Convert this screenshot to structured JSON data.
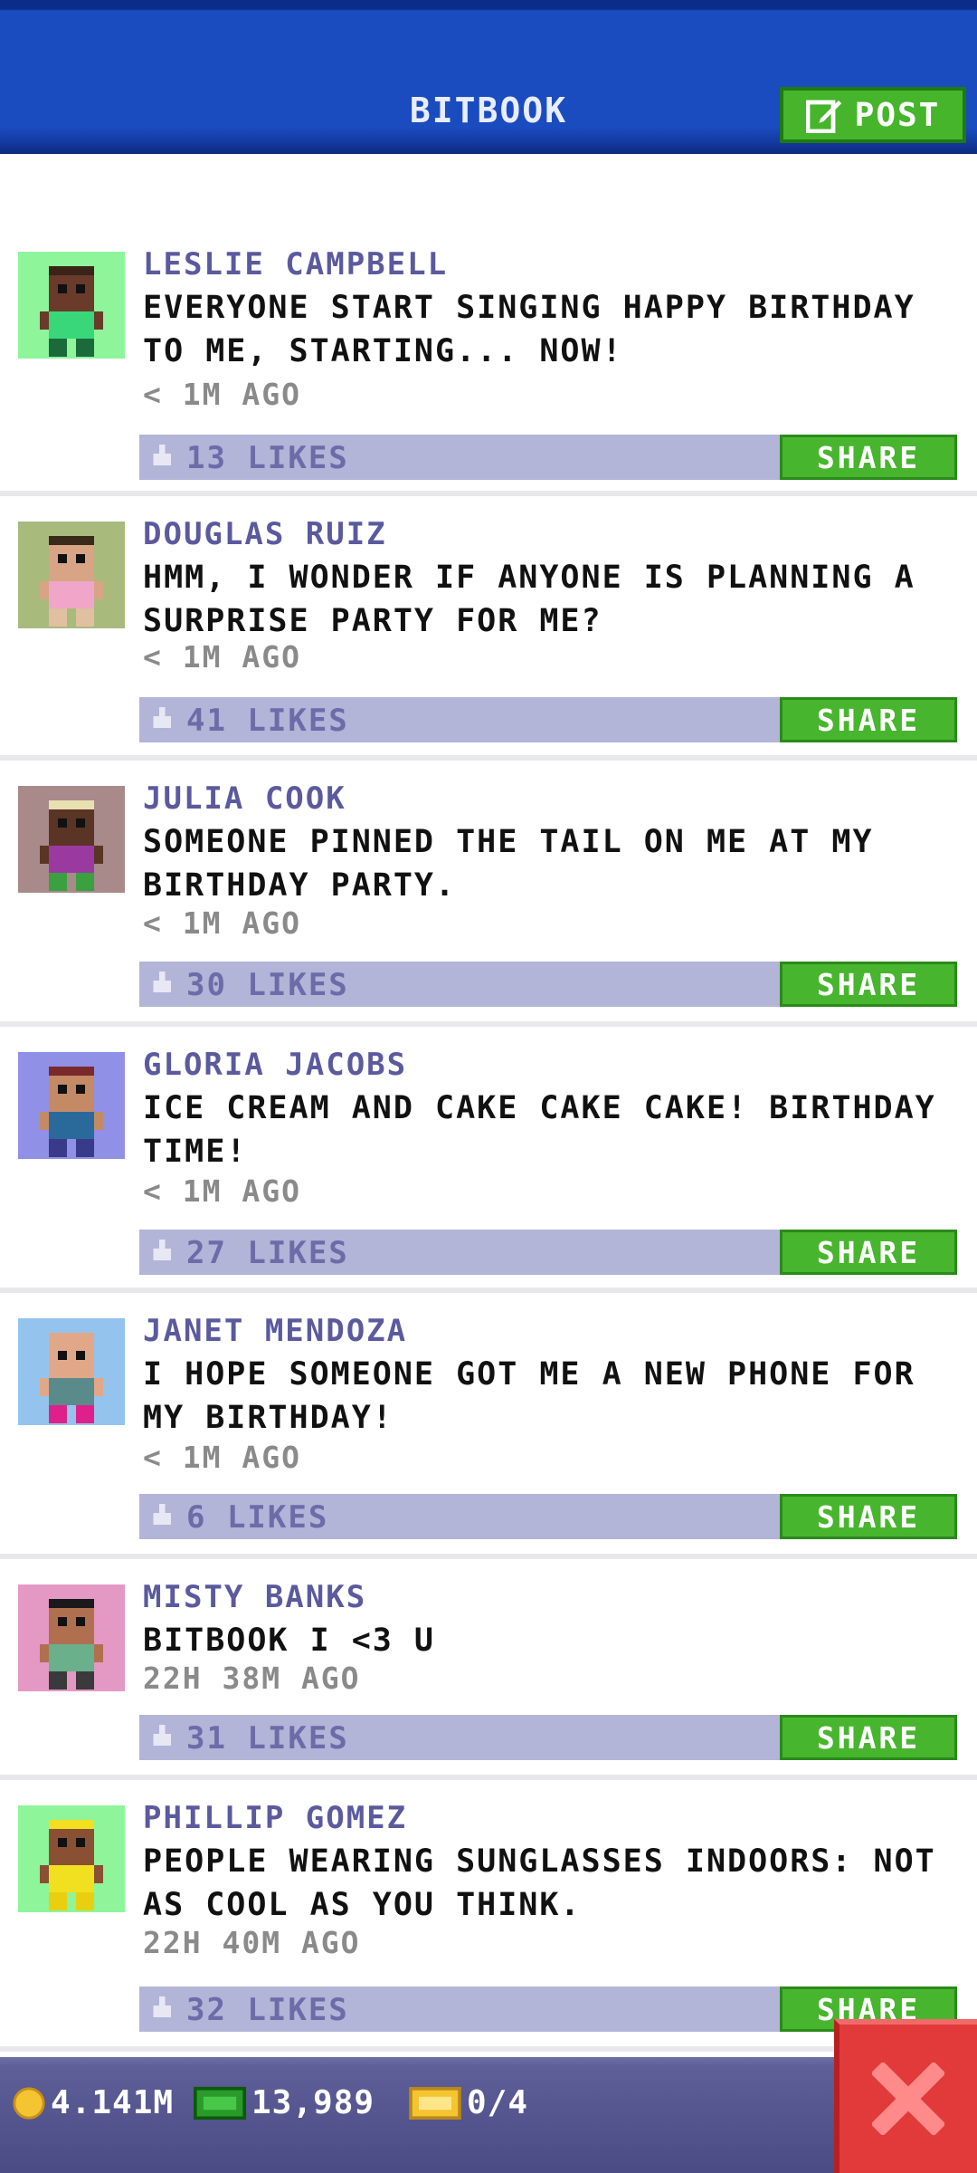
{
  "header": {
    "title": "BITBOOK",
    "post_label": "POST"
  },
  "posts": [
    {
      "name": "LESLIE CAMPBELL",
      "text": "EVERYONE START SINGING HAPPY BIRTHDAY TO ME, STARTING... NOW!",
      "time": "< 1M AGO",
      "likes": "13 LIKES",
      "share": "SHARE",
      "avatar_bg": "#8ef59a",
      "skin": "#6a3a2a",
      "shirt": "#39d67a",
      "pants": "#1b6a3a",
      "hair": "#3a2418"
    },
    {
      "name": "DOUGLAS RUIZ",
      "text": "HMM, I WONDER IF ANYONE IS PLANNING A SURPRISE PARTY FOR ME?",
      "time": "< 1M AGO",
      "likes": "41 LIKES",
      "share": "SHARE",
      "avatar_bg": "#a8ba7c",
      "skin": "#d7a585",
      "shirt": "#f0a6c8",
      "pants": "#e0c0a0",
      "hair": "#3a2a1a"
    },
    {
      "name": "JULIA COOK",
      "text": "SOMEONE PINNED THE TAIL ON ME AT MY BIRTHDAY PARTY.",
      "time": "< 1M AGO",
      "likes": "30 LIKES",
      "share": "SHARE",
      "avatar_bg": "#a88a8a",
      "skin": "#5a3424",
      "shirt": "#9a3aa0",
      "pants": "#3aa040",
      "hair": "#e8e0b0"
    },
    {
      "name": "GLORIA JACOBS",
      "text": "ICE CREAM AND CAKE CAKE CAKE! BIRTHDAY TIME!",
      "time": "< 1M AGO",
      "likes": "27 LIKES",
      "share": "SHARE",
      "avatar_bg": "#8f90e6",
      "skin": "#c48a66",
      "shirt": "#2a6a9a",
      "pants": "#3a3a8a",
      "hair": "#7a2a2a"
    },
    {
      "name": "JANET MENDOZA",
      "text": "I HOPE SOMEONE GOT ME A NEW PHONE FOR MY BIRTHDAY!",
      "time": "< 1M AGO",
      "likes": "6 LIKES",
      "share": "SHARE",
      "avatar_bg": "#94c4ee",
      "skin": "#e0a888",
      "shirt": "#5a8a8a",
      "pants": "#e0208a",
      "hair": "#e0a888"
    },
    {
      "name": "MISTY BANKS",
      "text": "BITBOOK I <3 U",
      "time": "22H 38M AGO",
      "likes": "31 LIKES",
      "share": "SHARE",
      "avatar_bg": "#e498c4",
      "skin": "#b07050",
      "shirt": "#6ab08a",
      "pants": "#3a3a3a",
      "hair": "#1a1a1a"
    },
    {
      "name": "PHILLIP GOMEZ",
      "text": "PEOPLE WEARING SUNGLASSES INDOORS: NOT AS COOL AS YOU THINK.",
      "time": "22H 40M AGO",
      "likes": "32 LIKES",
      "share": "SHARE",
      "avatar_bg": "#8ef59a",
      "skin": "#8a5034",
      "shirt": "#f0e020",
      "pants": "#e8d010",
      "hair": "#f0e020"
    }
  ],
  "bottom_bar": {
    "coins": "4.141M",
    "bux": "13,989",
    "tickets": "0/4"
  },
  "colors": {
    "header_blue": "#1a4cc0",
    "share_green": "#48b52e",
    "like_bar": "#b2b4d8",
    "name_purple": "#5b5a9e",
    "close_red": "#e23a3a"
  }
}
